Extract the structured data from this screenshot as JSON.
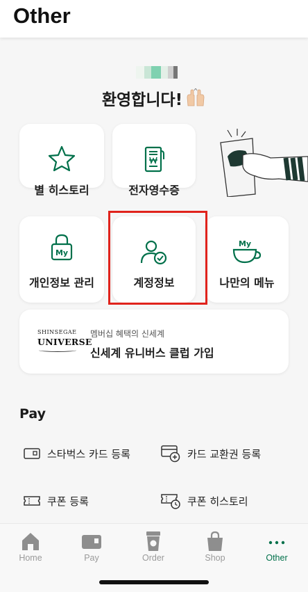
{
  "header": {
    "title": "Other"
  },
  "welcome": {
    "text": "환영합니다!"
  },
  "tiles": {
    "star_history": "별 히스토리",
    "e_receipt": "전자영수증",
    "privacy": "개인정보 관리",
    "account": "계정정보",
    "my_menu": "나만의 메뉴"
  },
  "universe": {
    "logo_top": "SHINSEGAE",
    "logo_bottom": "UNIVERSE",
    "subtitle": "멤버십 혜택의 신세계",
    "title": "신세계 유니버스 클럽 가입"
  },
  "pay": {
    "title": "Pay",
    "items": [
      {
        "label": "스타벅스 카드 등록",
        "icon": "card-icon"
      },
      {
        "label": "카드 교환권 등록",
        "icon": "card-add-icon"
      },
      {
        "label": "쿠폰 등록",
        "icon": "coupon-icon"
      },
      {
        "label": "쿠폰 히스토리",
        "icon": "coupon-history-icon"
      }
    ]
  },
  "nav": {
    "items": [
      {
        "label": "Home",
        "icon": "home-icon"
      },
      {
        "label": "Pay",
        "icon": "pay-icon"
      },
      {
        "label": "Order",
        "icon": "cup-icon"
      },
      {
        "label": "Shop",
        "icon": "shop-bag-icon"
      },
      {
        "label": "Other",
        "icon": "more-dots-icon",
        "active": true
      }
    ]
  },
  "colors": {
    "brand_green": "#00704a",
    "highlight_red": "#e0231c"
  }
}
